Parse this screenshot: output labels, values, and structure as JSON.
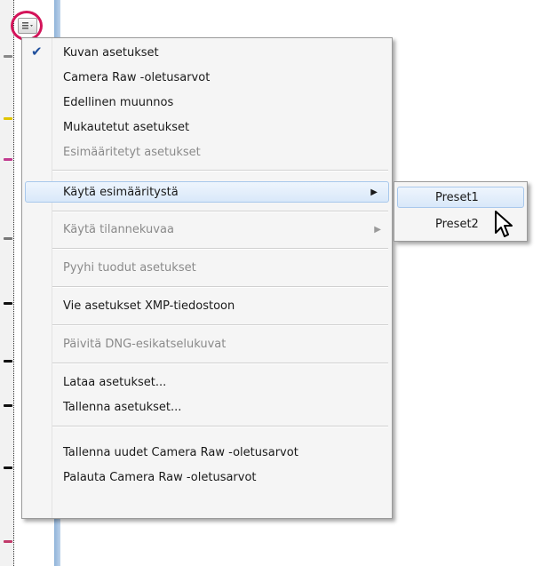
{
  "menu": {
    "items": [
      {
        "label": "Kuvan asetukset",
        "checked": true,
        "disabled": false
      },
      {
        "label": "Camera Raw -oletusarvot",
        "disabled": false
      },
      {
        "label": "Edellinen muunnos",
        "disabled": false
      },
      {
        "label": "Mukautetut asetukset",
        "disabled": false
      },
      {
        "label": "Esimääritetyt asetukset",
        "disabled": true
      },
      {
        "label": "Käytä esimääritystä",
        "disabled": false,
        "submenu": true,
        "highlighted": true
      },
      {
        "label": "Käytä tilannekuvaa",
        "disabled": true,
        "submenu": true
      },
      {
        "label": "Pyyhi tuodut asetukset",
        "disabled": true
      },
      {
        "label": "Vie asetukset XMP-tiedostoon",
        "disabled": false
      },
      {
        "label": "Päivitä DNG-esikatselukuvat",
        "disabled": true
      },
      {
        "label": "Lataa asetukset...",
        "disabled": false
      },
      {
        "label": "Tallenna asetukset...",
        "disabled": false
      },
      {
        "label": "Tallenna uudet Camera Raw -oletusarvot",
        "disabled": false
      },
      {
        "label": "Palauta Camera Raw -oletusarvot",
        "disabled": false
      }
    ]
  },
  "submenu": {
    "items": [
      {
        "label": "Preset1",
        "highlighted": true
      },
      {
        "label": "Preset2"
      }
    ]
  },
  "icons": {
    "check": "checkmark-icon",
    "submenu_arrow": "submenu-arrow-icon",
    "flyout": "flyout-menu-icon",
    "cursor": "mouse-pointer-icon"
  },
  "colors": {
    "highlight_ring": "#d4145a",
    "hover_bg": "#d9e8f9",
    "hover_border": "#a8c8ec",
    "disabled_text": "#8a8a8a"
  }
}
